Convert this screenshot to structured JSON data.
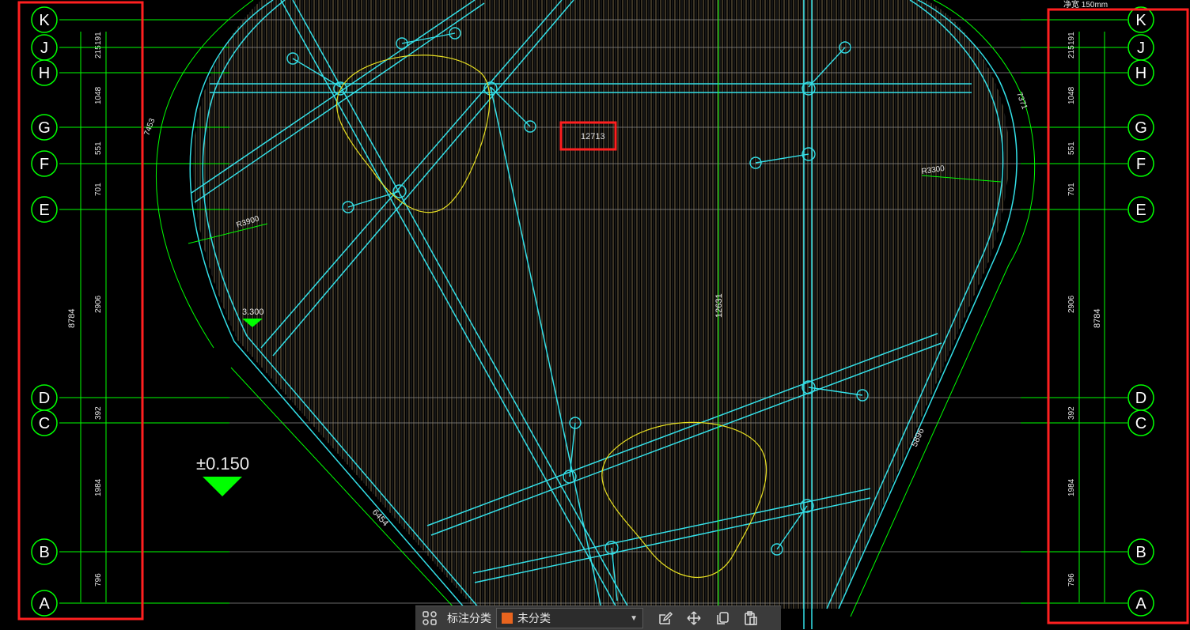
{
  "colors": {
    "background": "#000000",
    "axis_green": "#00ff00",
    "axis_grey": "#8a8a8a",
    "structure_cyan": "#33e0e8",
    "fill_tan": "#b8a070",
    "outline_yellow": "#e8e020",
    "highlight_red": "#ff2020",
    "category_orange": "#e8641e"
  },
  "axes": {
    "labels": [
      "K",
      "J",
      "H",
      "G",
      "F",
      "E",
      "D",
      "C",
      "B",
      "A"
    ]
  },
  "dimensions": {
    "segments": [
      "191",
      "215",
      "1048",
      "551",
      "701",
      "2906",
      "392",
      "1984",
      "796"
    ],
    "total": "8784",
    "top_clipped_note": "净宽 150mm"
  },
  "annotations": {
    "highlighted_dim": "12713",
    "center_dim": "12631",
    "left_radius": "R3900",
    "right_radius": "R3300",
    "left_arc": "7453",
    "right_arc": "7371",
    "left_edge_length": "6454",
    "right_edge_length": "5896",
    "small_elevation": "3.300",
    "main_elevation": "±0.150"
  },
  "toolbar": {
    "category_label": "标注分类",
    "category_value": "未分类",
    "layout_icon": "grid-layout-icon",
    "edit_icon": "edit-icon",
    "move_icon": "move-icon",
    "copy_icon": "copy-icon",
    "paste_icon": "paste-icon"
  }
}
